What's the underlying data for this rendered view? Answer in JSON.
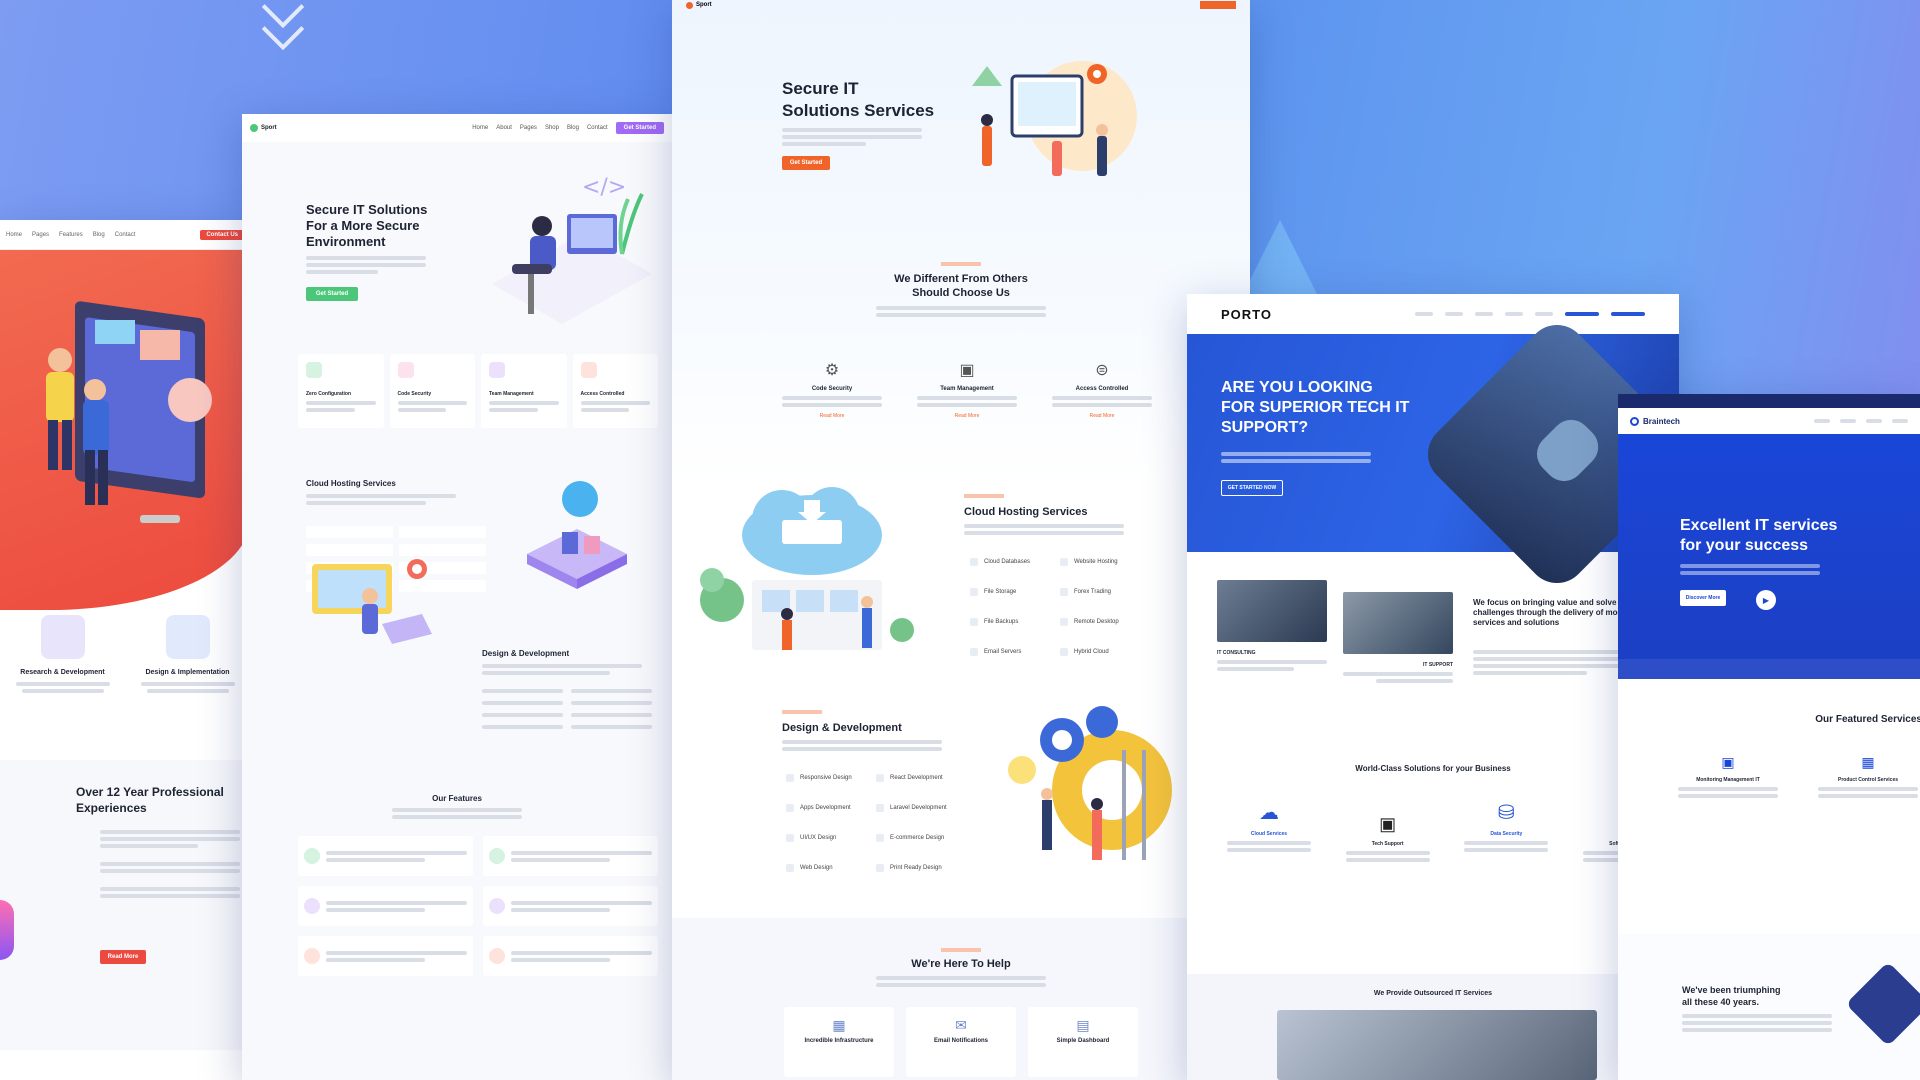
{
  "panel_a": {
    "nav": [
      "Home",
      "Pages",
      "Features",
      "Blog",
      "Contact"
    ],
    "nav_button": "Contact Us",
    "features": [
      {
        "title": "Research & Development"
      },
      {
        "title": "Design & Implementation"
      }
    ],
    "experience_title": "Over 12 Year Professional Experiences",
    "read_more": "Read More"
  },
  "panel_b": {
    "logo": "Sport",
    "nav": [
      "Home",
      "About",
      "Pages",
      "Shop",
      "Blog",
      "Contact"
    ],
    "nav_button": "Get Started",
    "hero_title_1": "Secure IT Solutions",
    "hero_title_2": "For a More Secure",
    "hero_title_3": "Environment",
    "hero_button": "Get Started",
    "features": [
      "Zero Configuration",
      "Code Security",
      "Team Management",
      "Access Controlled"
    ],
    "cloud_title": "Cloud Hosting Services",
    "design_title": "Design & Development",
    "our_features": "Our Features"
  },
  "panel_c": {
    "logo": "Sport",
    "hero_title_1": "Secure IT",
    "hero_title_2": "Solutions Services",
    "hero_button": "Get Started",
    "diff_title_1": "We Different From Others",
    "diff_title_2": "Should Choose Us",
    "features": [
      {
        "title": "Code Security",
        "link": "Read More"
      },
      {
        "title": "Team Management",
        "link": "Read More"
      },
      {
        "title": "Access Controlled",
        "link": "Read More"
      }
    ],
    "cloud_title": "Cloud Hosting Services",
    "cloud_items": [
      "Cloud Databases",
      "Website Hosting",
      "File Storage",
      "Forex Trading",
      "File Backups",
      "Remote Desktop",
      "Email Servers",
      "Hybrid Cloud"
    ],
    "design_title": "Design & Development",
    "design_items": [
      "Responsive Design",
      "React Development",
      "Apps Development",
      "Laravel Development",
      "UI/UX Design",
      "E-commerce Design",
      "Web Design",
      "Print Ready Design"
    ],
    "help_title": "We're Here To Help",
    "help_items": [
      "Incredible Infrastructure",
      "Email Notifications",
      "Simple Dashboard"
    ]
  },
  "panel_d": {
    "logo": "PORTO",
    "hero_title_1": "ARE YOU LOOKING",
    "hero_title_2": "FOR SUPERIOR TECH IT",
    "hero_title_3": "SUPPORT?",
    "hero_button": "GET STARTED NOW",
    "focus_title": "We focus on bringing value and solve business challenges through the delivery of modern IT services and solutions",
    "it_consulting": "IT CONSULTING",
    "it_support": "IT SUPPORT",
    "world_class": "World-Class Solutions for your Business",
    "services": [
      "Cloud Services",
      "Tech Support",
      "Data Security",
      "Software Dev"
    ],
    "outsourced": "We Provide Outsourced IT Services"
  },
  "panel_e": {
    "logo": "Braintech",
    "hero_title_1": "Excellent IT services",
    "hero_title_2": "for your success",
    "hero_button": "Discover More",
    "featured": "Our Featured Services",
    "services": [
      "Monitoring Management IT",
      "Product Control Services"
    ],
    "triumph_1": "We've been triumphing",
    "triumph_2": "all these 40 years."
  },
  "colors": {
    "background": "#6a95f0",
    "red": "#ec4a3e",
    "green": "#4cc77a",
    "orange": "#f0642a",
    "porto_blue": "#2656d6",
    "braintech_blue": "#1a46d8"
  }
}
